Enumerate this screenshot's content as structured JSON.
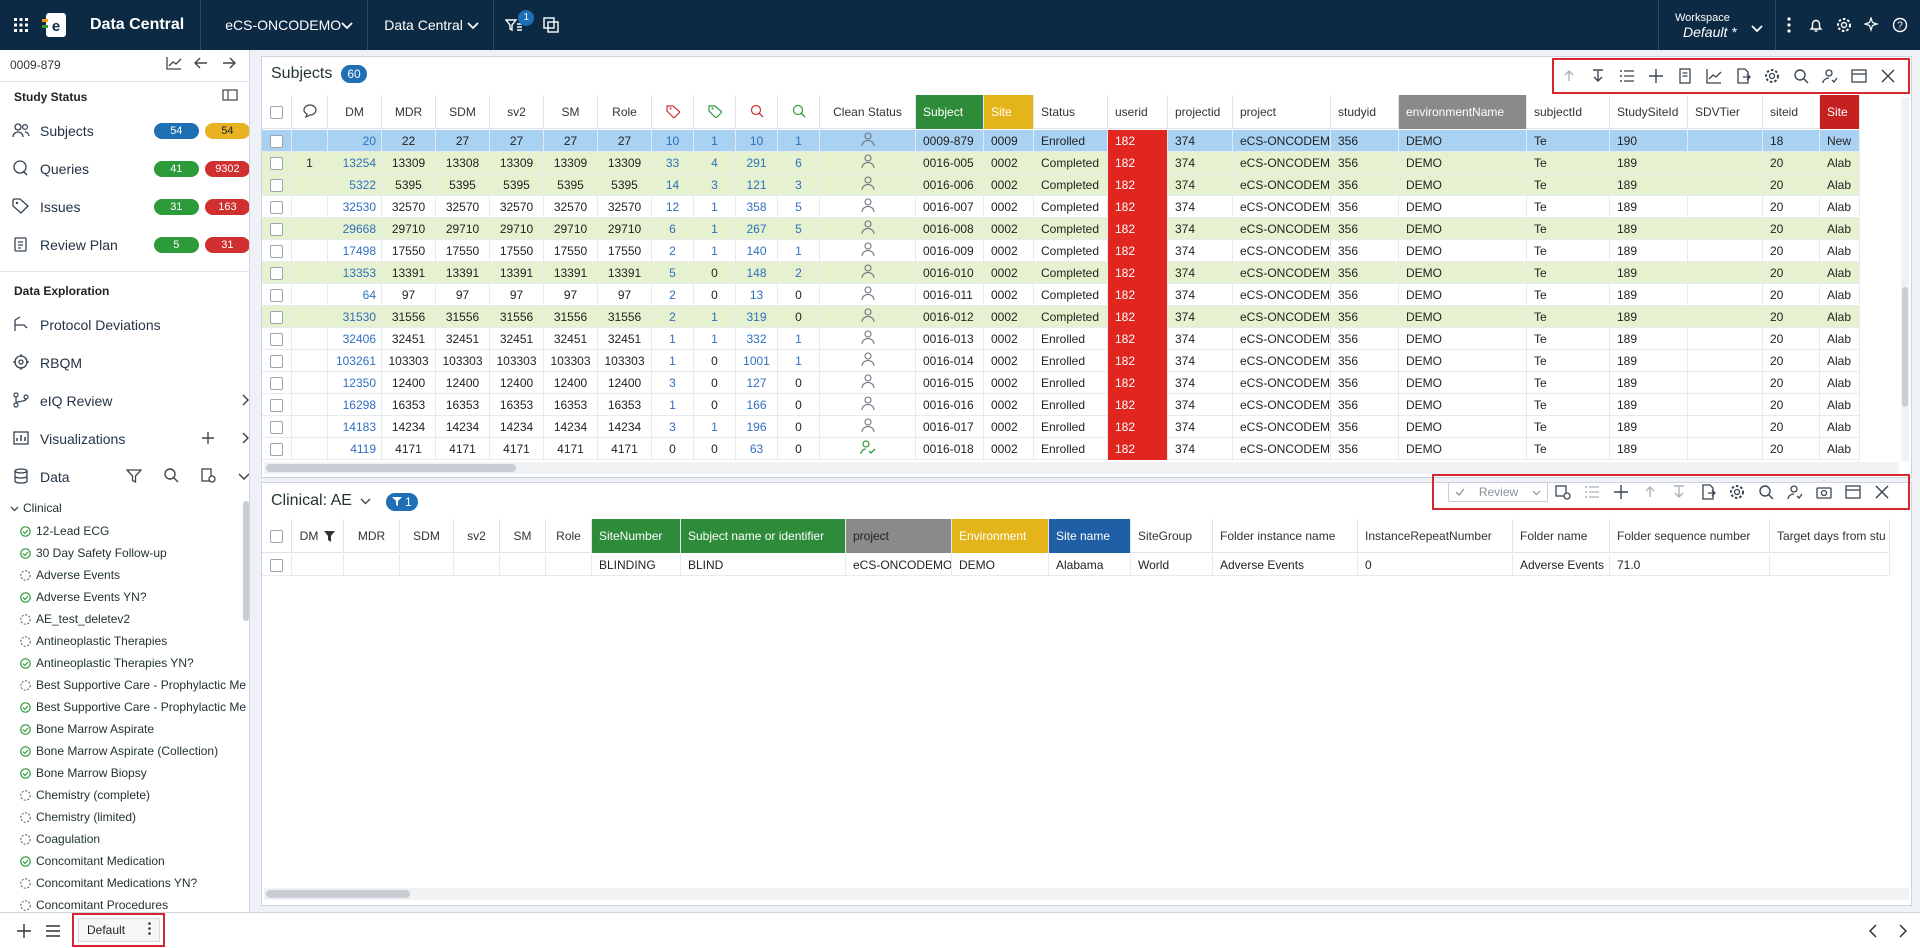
{
  "app": {
    "name": "Data Central",
    "study": "eCS-ONCODEMO",
    "module": "Data Central",
    "filter_badge": "1"
  },
  "workspace": {
    "label": "Workspace",
    "name": "Default",
    "modified_marker": "*"
  },
  "sidebar": {
    "subject_id": "0009-879",
    "study_status_title": "Study Status",
    "status_items": [
      {
        "label": "Subjects",
        "count_a": "54",
        "count_b": "54",
        "color_a": "#1f6fb5",
        "color_b": "#e8b223"
      },
      {
        "label": "Queries",
        "count_a": "41",
        "count_b": "9302",
        "color_a": "#2e9b3a",
        "color_b": "#d03030"
      },
      {
        "label": "Issues",
        "count_a": "31",
        "count_b": "163",
        "color_a": "#2e9b3a",
        "color_b": "#d03030"
      },
      {
        "label": "Review Plan",
        "count_a": "5",
        "count_b": "31",
        "color_a": "#2e9b3a",
        "color_b": "#d03030"
      }
    ],
    "data_exploration_title": "Data Exploration",
    "nav": [
      {
        "label": "Protocol Deviations",
        "icon": "deviation-icon"
      },
      {
        "label": "RBQM",
        "icon": "target-icon"
      },
      {
        "label": "eIQ Review",
        "icon": "branch-icon"
      },
      {
        "label": "Visualizations",
        "icon": "chart-icon"
      },
      {
        "label": "Data",
        "icon": "database-icon"
      }
    ],
    "tree_root": "Clinical",
    "tree": [
      {
        "label": "12-Lead ECG",
        "done": true
      },
      {
        "label": "30 Day Safety Follow-up",
        "done": true
      },
      {
        "label": "Adverse Events",
        "done": false
      },
      {
        "label": "Adverse Events YN?",
        "done": true
      },
      {
        "label": "AE_test_deletev2",
        "done": false
      },
      {
        "label": "Antineoplastic Therapies",
        "done": false
      },
      {
        "label": "Antineoplastic Therapies YN?",
        "done": true
      },
      {
        "label": "Best Supportive Care - Prophylactic Me",
        "done": false
      },
      {
        "label": "Best Supportive Care - Prophylactic Me",
        "done": true
      },
      {
        "label": "Bone Marrow Aspirate",
        "done": true
      },
      {
        "label": "Bone Marrow Aspirate (Collection)",
        "done": true
      },
      {
        "label": "Bone Marrow Biopsy",
        "done": true
      },
      {
        "label": "Chemistry (complete)",
        "done": false
      },
      {
        "label": "Chemistry (limited)",
        "done": false
      },
      {
        "label": "Coagulation",
        "done": false
      },
      {
        "label": "Concomitant Medication",
        "done": true
      },
      {
        "label": "Concomitant Medications YN?",
        "done": false
      },
      {
        "label": "Concomitant Procedures",
        "done": false
      }
    ]
  },
  "subjects_panel": {
    "title": "Subjects",
    "count": "60",
    "columns": [
      "DM",
      "MDR",
      "SDM",
      "sv2",
      "SM",
      "Role",
      "tag-icon",
      "tag-check-icon",
      "query-icon",
      "query-check-icon",
      "Clean Status",
      "Subject",
      "Site",
      "Status",
      "userid",
      "projectid",
      "project",
      "studyid",
      "environmentName",
      "subjectId",
      "StudySiteId",
      "SDVTier",
      "siteid",
      "Site"
    ],
    "rows": [
      {
        "comment": "",
        "dm": "20",
        "mdr": "22",
        "sdm": "27",
        "sv2": "27",
        "sm": "27",
        "role": "27",
        "t1": "10",
        "t2": "1",
        "q1": "10",
        "q2": "1",
        "clean": "person",
        "subject": "0009-879",
        "site": "0009",
        "status": "Enrolled",
        "userid": "182",
        "projectid": "374",
        "project": "eCS-ONCODEMO",
        "studyid": "356",
        "env": "DEMO",
        "subjectId": "Te",
        "studySiteId": "190",
        "sdv": "",
        "siteid": "18",
        "siteName": "New"
      },
      {
        "comment": "1",
        "dm": "13254",
        "mdr": "13309",
        "sdm": "13308",
        "sv2": "13309",
        "sm": "13309",
        "role": "13309",
        "t1": "33",
        "t2": "4",
        "q1": "291",
        "q2": "6",
        "clean": "person",
        "subject": "0016-005",
        "site": "0002",
        "status": "Completed",
        "userid": "182",
        "projectid": "374",
        "project": "eCS-ONCODEMO",
        "studyid": "356",
        "env": "DEMO",
        "subjectId": "Te",
        "studySiteId": "189",
        "sdv": "",
        "siteid": "20",
        "siteName": "Alab"
      },
      {
        "comment": "",
        "dm": "5322",
        "mdr": "5395",
        "sdm": "5395",
        "sv2": "5395",
        "sm": "5395",
        "role": "5395",
        "t1": "14",
        "t2": "3",
        "q1": "121",
        "q2": "3",
        "clean": "person",
        "subject": "0016-006",
        "site": "0002",
        "status": "Completed",
        "userid": "182",
        "projectid": "374",
        "project": "eCS-ONCODEMO",
        "studyid": "356",
        "env": "DEMO",
        "subjectId": "Te",
        "studySiteId": "189",
        "sdv": "",
        "siteid": "20",
        "siteName": "Alab"
      },
      {
        "comment": "",
        "dm": "32530",
        "mdr": "32570",
        "sdm": "32570",
        "sv2": "32570",
        "sm": "32570",
        "role": "32570",
        "t1": "12",
        "t2": "1",
        "q1": "358",
        "q2": "5",
        "clean": "person",
        "subject": "0016-007",
        "site": "0002",
        "status": "Completed",
        "userid": "182",
        "projectid": "374",
        "project": "eCS-ONCODEMO",
        "studyid": "356",
        "env": "DEMO",
        "subjectId": "Te",
        "studySiteId": "189",
        "sdv": "",
        "siteid": "20",
        "siteName": "Alab"
      },
      {
        "comment": "",
        "dm": "29668",
        "mdr": "29710",
        "sdm": "29710",
        "sv2": "29710",
        "sm": "29710",
        "role": "29710",
        "t1": "6",
        "t2": "1",
        "q1": "267",
        "q2": "5",
        "clean": "person",
        "subject": "0016-008",
        "site": "0002",
        "status": "Completed",
        "userid": "182",
        "projectid": "374",
        "project": "eCS-ONCODEMO",
        "studyid": "356",
        "env": "DEMO",
        "subjectId": "Te",
        "studySiteId": "189",
        "sdv": "",
        "siteid": "20",
        "siteName": "Alab"
      },
      {
        "comment": "",
        "dm": "17498",
        "mdr": "17550",
        "sdm": "17550",
        "sv2": "17550",
        "sm": "17550",
        "role": "17550",
        "t1": "2",
        "t2": "1",
        "q1": "140",
        "q2": "1",
        "clean": "person",
        "subject": "0016-009",
        "site": "0002",
        "status": "Completed",
        "userid": "182",
        "projectid": "374",
        "project": "eCS-ONCODEMO",
        "studyid": "356",
        "env": "DEMO",
        "subjectId": "Te",
        "studySiteId": "189",
        "sdv": "",
        "siteid": "20",
        "siteName": "Alab"
      },
      {
        "comment": "",
        "dm": "13353",
        "mdr": "13391",
        "sdm": "13391",
        "sv2": "13391",
        "sm": "13391",
        "role": "13391",
        "t1": "5",
        "t2": "0",
        "q1": "148",
        "q2": "2",
        "clean": "person",
        "subject": "0016-010",
        "site": "0002",
        "status": "Completed",
        "userid": "182",
        "projectid": "374",
        "project": "eCS-ONCODEMO",
        "studyid": "356",
        "env": "DEMO",
        "subjectId": "Te",
        "studySiteId": "189",
        "sdv": "",
        "siteid": "20",
        "siteName": "Alab"
      },
      {
        "comment": "",
        "dm": "64",
        "mdr": "97",
        "sdm": "97",
        "sv2": "97",
        "sm": "97",
        "role": "97",
        "t1": "2",
        "t2": "0",
        "q1": "13",
        "q2": "0",
        "clean": "person",
        "subject": "0016-011",
        "site": "0002",
        "status": "Completed",
        "userid": "182",
        "projectid": "374",
        "project": "eCS-ONCODEMO",
        "studyid": "356",
        "env": "DEMO",
        "subjectId": "Te",
        "studySiteId": "189",
        "sdv": "",
        "siteid": "20",
        "siteName": "Alab"
      },
      {
        "comment": "",
        "dm": "31530",
        "mdr": "31556",
        "sdm": "31556",
        "sv2": "31556",
        "sm": "31556",
        "role": "31556",
        "t1": "2",
        "t2": "1",
        "q1": "319",
        "q2": "0",
        "clean": "person",
        "subject": "0016-012",
        "site": "0002",
        "status": "Completed",
        "userid": "182",
        "projectid": "374",
        "project": "eCS-ONCODEMO",
        "studyid": "356",
        "env": "DEMO",
        "subjectId": "Te",
        "studySiteId": "189",
        "sdv": "",
        "siteid": "20",
        "siteName": "Alab"
      },
      {
        "comment": "",
        "dm": "32406",
        "mdr": "32451",
        "sdm": "32451",
        "sv2": "32451",
        "sm": "32451",
        "role": "32451",
        "t1": "1",
        "t2": "1",
        "q1": "332",
        "q2": "1",
        "clean": "person",
        "subject": "0016-013",
        "site": "0002",
        "status": "Enrolled",
        "userid": "182",
        "projectid": "374",
        "project": "eCS-ONCODEMO",
        "studyid": "356",
        "env": "DEMO",
        "subjectId": "Te",
        "studySiteId": "189",
        "sdv": "",
        "siteid": "20",
        "siteName": "Alab"
      },
      {
        "comment": "",
        "dm": "103261",
        "mdr": "103303",
        "sdm": "103303",
        "sv2": "103303",
        "sm": "103303",
        "role": "103303",
        "t1": "1",
        "t2": "0",
        "q1": "1001",
        "q2": "1",
        "clean": "person",
        "subject": "0016-014",
        "site": "0002",
        "status": "Enrolled",
        "userid": "182",
        "projectid": "374",
        "project": "eCS-ONCODEMO",
        "studyid": "356",
        "env": "DEMO",
        "subjectId": "Te",
        "studySiteId": "189",
        "sdv": "",
        "siteid": "20",
        "siteName": "Alab"
      },
      {
        "comment": "",
        "dm": "12350",
        "mdr": "12400",
        "sdm": "12400",
        "sv2": "12400",
        "sm": "12400",
        "role": "12400",
        "t1": "3",
        "t2": "0",
        "q1": "127",
        "q2": "0",
        "clean": "person",
        "subject": "0016-015",
        "site": "0002",
        "status": "Enrolled",
        "userid": "182",
        "projectid": "374",
        "project": "eCS-ONCODEMO",
        "studyid": "356",
        "env": "DEMO",
        "subjectId": "Te",
        "studySiteId": "189",
        "sdv": "",
        "siteid": "20",
        "siteName": "Alab"
      },
      {
        "comment": "",
        "dm": "16298",
        "mdr": "16353",
        "sdm": "16353",
        "sv2": "16353",
        "sm": "16353",
        "role": "16353",
        "t1": "1",
        "t2": "0",
        "q1": "166",
        "q2": "0",
        "clean": "person",
        "subject": "0016-016",
        "site": "0002",
        "status": "Enrolled",
        "userid": "182",
        "projectid": "374",
        "project": "eCS-ONCODEMO",
        "studyid": "356",
        "env": "DEMO",
        "subjectId": "Te",
        "studySiteId": "189",
        "sdv": "",
        "siteid": "20",
        "siteName": "Alab"
      },
      {
        "comment": "",
        "dm": "14183",
        "mdr": "14234",
        "sdm": "14234",
        "sv2": "14234",
        "sm": "14234",
        "role": "14234",
        "t1": "3",
        "t2": "1",
        "q1": "196",
        "q2": "0",
        "clean": "person",
        "subject": "0016-017",
        "site": "0002",
        "status": "Enrolled",
        "userid": "182",
        "projectid": "374",
        "project": "eCS-ONCODEMO",
        "studyid": "356",
        "env": "DEMO",
        "subjectId": "Te",
        "studySiteId": "189",
        "sdv": "",
        "siteid": "20",
        "siteName": "Alab"
      },
      {
        "comment": "",
        "dm": "4119",
        "mdr": "4171",
        "sdm": "4171",
        "sv2": "4171",
        "sm": "4171",
        "role": "4171",
        "t1": "0",
        "t2": "0",
        "q1": "63",
        "q2": "0",
        "clean": "person-check",
        "subject": "0016-018",
        "site": "0002",
        "status": "Enrolled",
        "userid": "182",
        "projectid": "374",
        "project": "eCS-ONCODEMO",
        "studyid": "356",
        "env": "DEMO",
        "subjectId": "Te",
        "studySiteId": "189",
        "sdv": "",
        "siteid": "20",
        "siteName": "Alab"
      }
    ]
  },
  "clinical_panel": {
    "title": "Clinical: AE",
    "filter_count": "1",
    "review_label": "Review",
    "columns": [
      "DM",
      "MDR",
      "SDM",
      "sv2",
      "SM",
      "Role",
      "SiteNumber",
      "Subject name or identifier",
      "project",
      "Environment",
      "Site name",
      "SiteGroup",
      "Folder instance name",
      "InstanceRepeatNumber",
      "Folder name",
      "Folder sequence number",
      "Target days from stu"
    ],
    "rows": [
      {
        "dm": "",
        "mdr": "",
        "sdm": "",
        "sv2": "",
        "sm": "",
        "role": "",
        "siteNumber": "BLINDING",
        "subjectName": "BLIND",
        "project": "eCS-ONCODEMO",
        "environment": "DEMO",
        "siteName": "Alabama",
        "siteGroup": "World",
        "folderInstance": "Adverse Events",
        "instanceRepeat": "0",
        "folderName": "Adverse Events",
        "folderSeq": "71.0",
        "targetDays": ""
      }
    ]
  },
  "bottom": {
    "tab_label": "Default"
  },
  "colors": {
    "topbar": "#0d2a44",
    "accent": "#1f6fb5",
    "red": "#e0261f",
    "subject_green": "#2e8b3a",
    "site_yellow": "#e3b51a",
    "env_gray": "#8a8a8a",
    "site_blue": "#1f5fa5",
    "highlight_border": "#d8262e"
  }
}
